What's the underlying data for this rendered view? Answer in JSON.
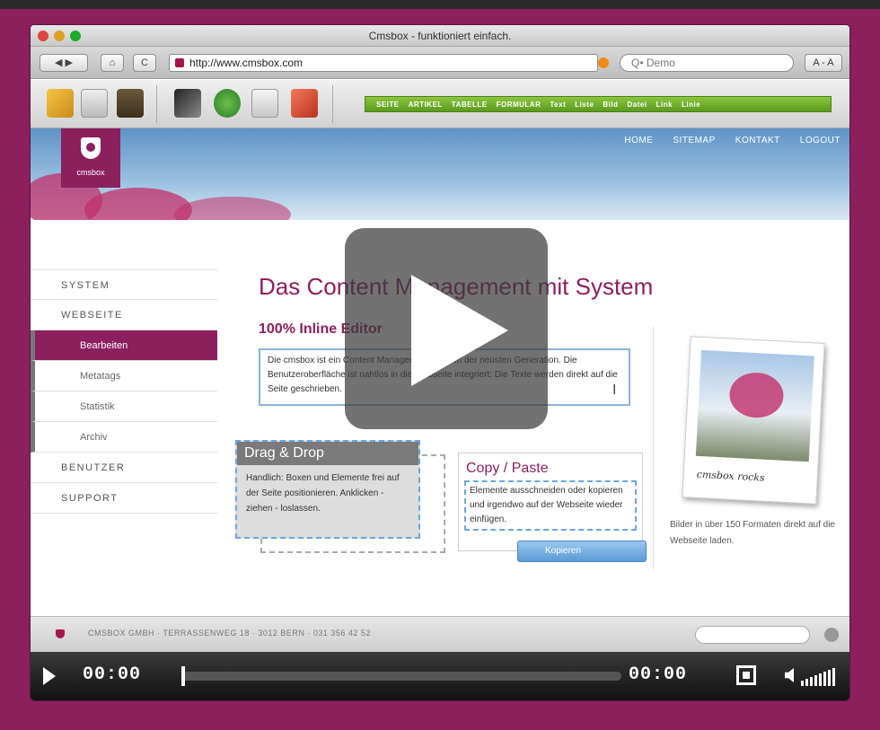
{
  "browser": {
    "window_title": "Cmsbox - funktioniert einfach.",
    "url": "http://www.cmsbox.com",
    "search_value": "Q• Demo",
    "font_buttons": "A - A",
    "nav": {
      "back": "◀ ▶",
      "home": "⌂",
      "reload": "C"
    }
  },
  "cms_toolbar": {
    "tabs": [
      "SEITE",
      "ARTIKEL",
      "TABELLE",
      "FORMULAR",
      "Text",
      "Liste",
      "Bild",
      "Datei",
      "Link",
      "Linie"
    ]
  },
  "site": {
    "logo_text": "cmsbox",
    "top_nav": [
      "HOME",
      "SITEMAP",
      "KONTAKT",
      "LOGOUT"
    ],
    "sidebar": [
      {
        "label": "SYSTEM",
        "kind": "top"
      },
      {
        "label": "WEBSEITE",
        "kind": "top"
      },
      {
        "label": "Bearbeiten",
        "kind": "sub-active"
      },
      {
        "label": "Metatags",
        "kind": "sub"
      },
      {
        "label": "Statistik",
        "kind": "sub"
      },
      {
        "label": "Archiv",
        "kind": "sub"
      },
      {
        "label": "BENUTZER",
        "kind": "top"
      },
      {
        "label": "SUPPORT",
        "kind": "top"
      }
    ],
    "page_title": "Das Content Management mit System",
    "inline_heading": "100% Inline Editor",
    "inline_text": "Die cmsbox ist ein Content Management System der neusten Generation. Die Benutzeroberfläche ist nahtlos in die Webseite integriert: Die Texte werden direkt auf die Seite geschrieben.",
    "drag": {
      "title": "Drag & Drop",
      "text": "Handlich: Boxen und Elemente frei auf der Seite positionieren. Anklicken - ziehen - loslassen."
    },
    "copy": {
      "title": "Copy / Paste",
      "text": "Elemente ausschneiden oder kopieren und irgendwo auf der Webseite wieder einfügen.",
      "button": "Kopieren"
    },
    "photo_caption": "cmsbox rocks",
    "image_text": "Bilder in über 150 Formaten direkt auf die Webseite laden.",
    "footer_text": "CMSBOX GMBH  ·  TERRASSENWEG 18  ·  3012 BERN  ·  031 356 42 52"
  },
  "player": {
    "current_time": "00:00",
    "duration": "00:00",
    "progress": 0
  },
  "colors": {
    "brand": "#8c1f5e",
    "green": "#6aa82a",
    "highlight": "#6aa6dd"
  }
}
